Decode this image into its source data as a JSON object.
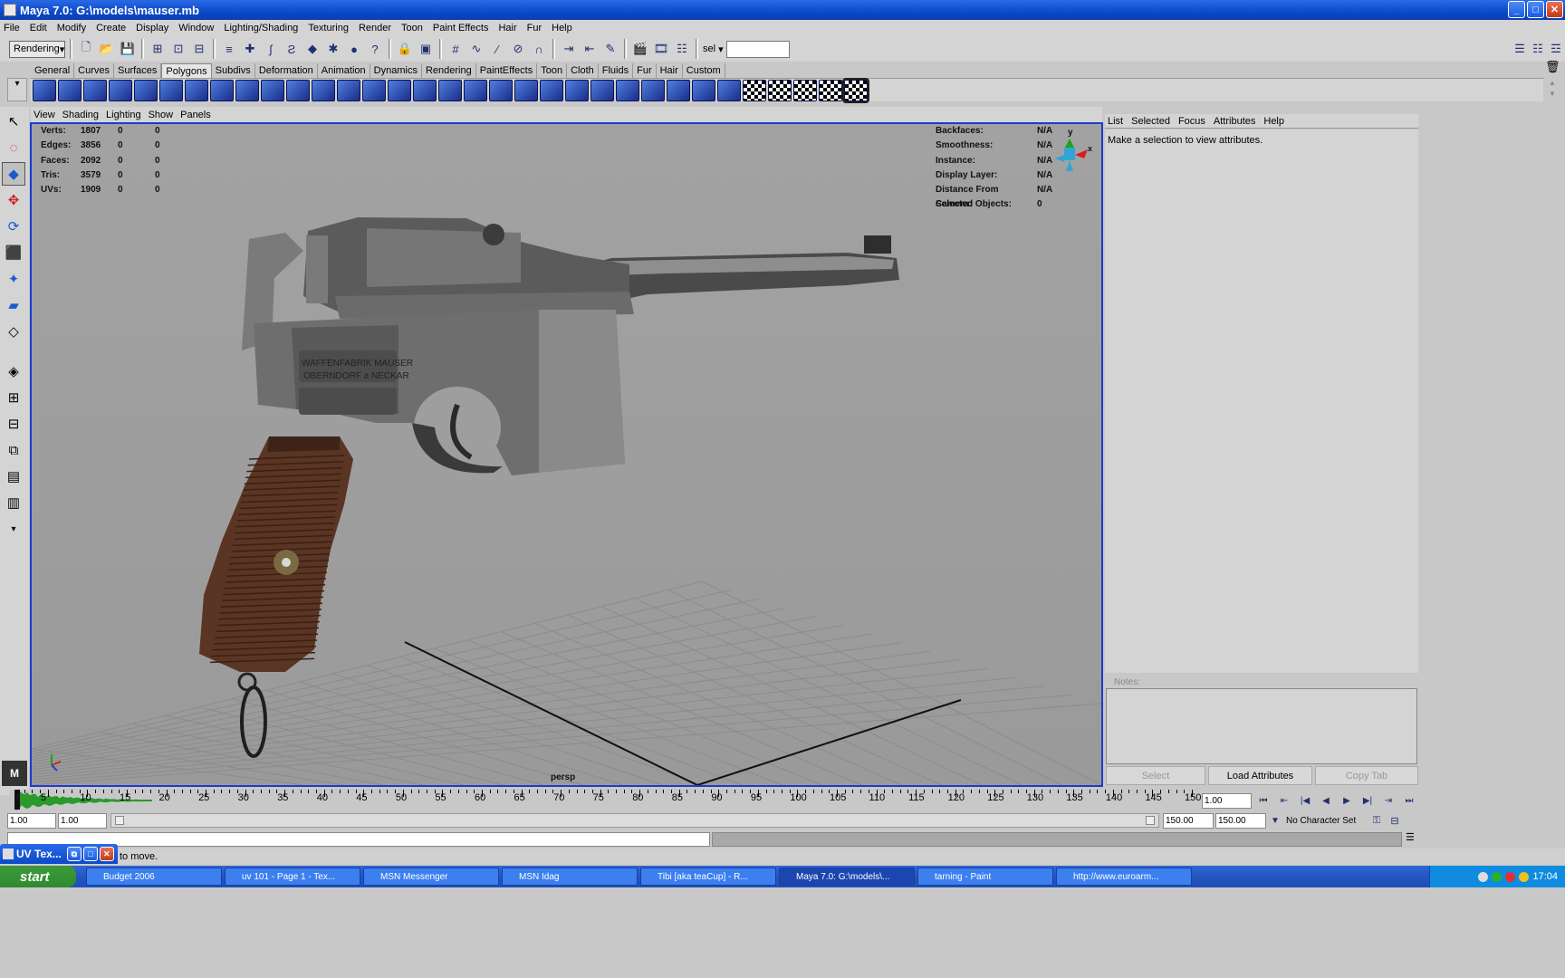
{
  "window": {
    "title": "Maya 7.0: G:\\models\\mauser.mb"
  },
  "menubar": [
    "File",
    "Edit",
    "Modify",
    "Create",
    "Display",
    "Window",
    "Lighting/Shading",
    "Texturing",
    "Render",
    "Toon",
    "Paint Effects",
    "Hair",
    "Fur",
    "Help"
  ],
  "statusline": {
    "menu_set": "Rendering",
    "sel_label": "sel"
  },
  "shelf_tabs": [
    "General",
    "Curves",
    "Surfaces",
    "Polygons",
    "Subdivs",
    "Deformation",
    "Animation",
    "Dynamics",
    "Rendering",
    "PaintEffects",
    "Toon",
    "Cloth",
    "Fluids",
    "Fur",
    "Hair",
    "Custom"
  ],
  "shelf_active": "Polygons",
  "viewport": {
    "menu": [
      "View",
      "Shading",
      "Lighting",
      "Show",
      "Panels"
    ],
    "hud_left": [
      {
        "label": "Verts:",
        "a": "1807",
        "b": "0",
        "c": "0"
      },
      {
        "label": "Edges:",
        "a": "3856",
        "b": "0",
        "c": "0"
      },
      {
        "label": "Faces:",
        "a": "2092",
        "b": "0",
        "c": "0"
      },
      {
        "label": "Tris:",
        "a": "3579",
        "b": "0",
        "c": "0"
      },
      {
        "label": "UVs:",
        "a": "1909",
        "b": "0",
        "c": "0"
      }
    ],
    "hud_right": [
      {
        "label": "Backfaces:",
        "value": "N/A"
      },
      {
        "label": "Smoothness:",
        "value": "N/A"
      },
      {
        "label": "Instance:",
        "value": "N/A"
      },
      {
        "label": "Display Layer:",
        "value": "N/A"
      },
      {
        "label": "Distance From Camera:",
        "value": "N/A"
      },
      {
        "label": "Selected Objects:",
        "value": "0"
      }
    ],
    "camera": "persp",
    "engraving_line1": "WAFFENFABRIK MAUSER",
    "engraving_line2": "OBERNDORF a NECKAR"
  },
  "attribute_editor": {
    "menu": [
      "List",
      "Selected",
      "Focus",
      "Attributes",
      "Help"
    ],
    "message": "Make a selection to view attributes.",
    "notes_label": "Notes:",
    "buttons": {
      "select": "Select",
      "load": "Load Attributes",
      "copy": "Copy Tab"
    }
  },
  "timeline": {
    "ticks": [
      "5",
      "10",
      "15",
      "20",
      "25",
      "30",
      "35",
      "40",
      "45",
      "50",
      "55",
      "60",
      "65",
      "70",
      "75",
      "80",
      "85",
      "90",
      "95",
      "100",
      "105",
      "110",
      "115",
      "120",
      "125",
      "130",
      "135",
      "140",
      "145",
      "150"
    ],
    "current_frame": "1.00"
  },
  "range": {
    "start": "1.00",
    "inner_start": "1.00",
    "inner_end": "150.00",
    "end": "150.00",
    "character_set": "No Character Set"
  },
  "helpline": {
    "text": "to move."
  },
  "uv_window": {
    "title": "UV Tex..."
  },
  "taskbar": {
    "start": "start",
    "tasks": [
      "Budget 2006",
      "uv 101 - Page 1 - Tex...",
      "MSN Messenger",
      "MSN Idag",
      "Tibi [aka teaCup] - R...",
      "Maya 7.0: G:\\models\\...",
      "tarning - Paint",
      "http://www.euroarm..."
    ],
    "active_index": 5,
    "clock": "17:04"
  }
}
